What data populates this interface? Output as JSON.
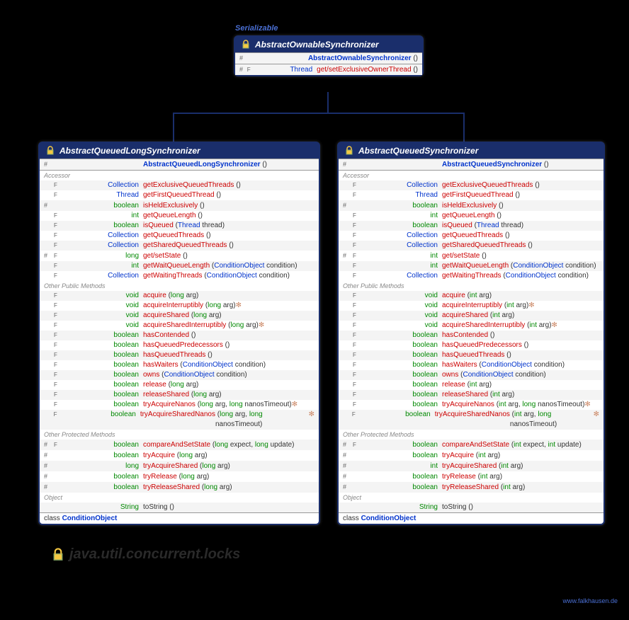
{
  "interface": "Serializable",
  "package": "java.util.concurrent.locks",
  "footer": "www.falkhausen.de",
  "parent": {
    "name": "AbstractOwnableSynchronizer",
    "ctor": "AbstractOwnableSynchronizer",
    "rows": [
      {
        "vis": "#",
        "mod": "F",
        "type": "Thread",
        "ctype": true,
        "method": "get/setExclusiveOwnerThread",
        "params": "()"
      }
    ]
  },
  "left": {
    "name": "AbstractQueuedLongSynchronizer",
    "ctor": "AbstractQueuedLongSynchronizer",
    "accessor": [
      {
        "vis": "",
        "mod": "F",
        "type": "Collection<Thread>",
        "ctype": true,
        "method": "getExclusiveQueuedThreads",
        "params": "()"
      },
      {
        "vis": "",
        "mod": "F",
        "type": "Thread",
        "ctype": true,
        "method": "getFirstQueuedThread",
        "params": "()"
      },
      {
        "vis": "#",
        "mod": "",
        "type": "boolean",
        "method": "isHeldExclusively",
        "params": "()"
      },
      {
        "vis": "",
        "mod": "F",
        "type": "int",
        "method": "getQueueLength",
        "params": "()"
      },
      {
        "vis": "",
        "mod": "F",
        "type": "boolean",
        "method": "isQueued",
        "params": "(Thread thread)"
      },
      {
        "vis": "",
        "mod": "F",
        "type": "Collection<Thread>",
        "ctype": true,
        "method": "getQueuedThreads",
        "params": "()"
      },
      {
        "vis": "",
        "mod": "F",
        "type": "Collection<Thread>",
        "ctype": true,
        "method": "getSharedQueuedThreads",
        "params": "()"
      },
      {
        "vis": "#",
        "mod": "F",
        "type": "long",
        "method": "get/setState",
        "params": "()"
      },
      {
        "vis": "",
        "mod": "F",
        "type": "int",
        "method": "getWaitQueueLength",
        "params": "(ConditionObject condition)"
      },
      {
        "vis": "",
        "mod": "F",
        "type": "Collection<Thread>",
        "ctype": true,
        "method": "getWaitingThreads",
        "params": "(ConditionObject condition)"
      }
    ],
    "public": [
      {
        "vis": "",
        "mod": "F",
        "type": "void",
        "method": "acquire",
        "params": "(long arg)"
      },
      {
        "vis": "",
        "mod": "F",
        "type": "void",
        "method": "acquireInterruptibly",
        "params": "(long arg)",
        "exc": "✻"
      },
      {
        "vis": "",
        "mod": "F",
        "type": "void",
        "method": "acquireShared",
        "params": "(long arg)"
      },
      {
        "vis": "",
        "mod": "F",
        "type": "void",
        "method": "acquireSharedInterruptibly",
        "params": "(long arg)",
        "exc": "✻"
      },
      {
        "vis": "",
        "mod": "F",
        "type": "boolean",
        "method": "hasContended",
        "params": "()"
      },
      {
        "vis": "",
        "mod": "F",
        "type": "boolean",
        "method": "hasQueuedPredecessors",
        "params": "()"
      },
      {
        "vis": "",
        "mod": "F",
        "type": "boolean",
        "method": "hasQueuedThreads",
        "params": "()"
      },
      {
        "vis": "",
        "mod": "F",
        "type": "boolean",
        "method": "hasWaiters",
        "params": "(ConditionObject condition)"
      },
      {
        "vis": "",
        "mod": "F",
        "type": "boolean",
        "method": "owns",
        "params": "(ConditionObject condition)"
      },
      {
        "vis": "",
        "mod": "F",
        "type": "boolean",
        "method": "release",
        "params": "(long arg)"
      },
      {
        "vis": "",
        "mod": "F",
        "type": "boolean",
        "method": "releaseShared",
        "params": "(long arg)"
      },
      {
        "vis": "",
        "mod": "F",
        "type": "boolean",
        "method": "tryAcquireNanos",
        "params": "(long arg, long nanosTimeout)",
        "exc": "✻"
      },
      {
        "vis": "",
        "mod": "F",
        "type": "boolean",
        "method": "tryAcquireSharedNanos",
        "params": "(long arg, long nanosTimeout)",
        "exc": "✻"
      }
    ],
    "protected": [
      {
        "vis": "#",
        "mod": "F",
        "type": "boolean",
        "method": "compareAndSetState",
        "params": "(long expect, long update)"
      },
      {
        "vis": "#",
        "mod": "",
        "type": "boolean",
        "method": "tryAcquire",
        "params": "(long arg)"
      },
      {
        "vis": "#",
        "mod": "",
        "type": "long",
        "method": "tryAcquireShared",
        "params": "(long arg)"
      },
      {
        "vis": "#",
        "mod": "",
        "type": "boolean",
        "method": "tryRelease",
        "params": "(long arg)"
      },
      {
        "vis": "#",
        "mod": "",
        "type": "boolean",
        "method": "tryReleaseShared",
        "params": "(long arg)"
      }
    ],
    "object": [
      {
        "vis": "",
        "mod": "",
        "type": "String",
        "method_plain": "toString",
        "params": "()"
      }
    ],
    "inner": "ConditionObject"
  },
  "right": {
    "name": "AbstractQueuedSynchronizer",
    "ctor": "AbstractQueuedSynchronizer",
    "accessor": [
      {
        "vis": "",
        "mod": "F",
        "type": "Collection<Thread>",
        "ctype": true,
        "method": "getExclusiveQueuedThreads",
        "params": "()"
      },
      {
        "vis": "",
        "mod": "F",
        "type": "Thread",
        "ctype": true,
        "method": "getFirstQueuedThread",
        "params": "()"
      },
      {
        "vis": "#",
        "mod": "",
        "type": "boolean",
        "method": "isHeldExclusively",
        "params": "()"
      },
      {
        "vis": "",
        "mod": "F",
        "type": "int",
        "method": "getQueueLength",
        "params": "()"
      },
      {
        "vis": "",
        "mod": "F",
        "type": "boolean",
        "method": "isQueued",
        "params": "(Thread thread)"
      },
      {
        "vis": "",
        "mod": "F",
        "type": "Collection<Thread>",
        "ctype": true,
        "method": "getQueuedThreads",
        "params": "()"
      },
      {
        "vis": "",
        "mod": "F",
        "type": "Collection<Thread>",
        "ctype": true,
        "method": "getSharedQueuedThreads",
        "params": "()"
      },
      {
        "vis": "#",
        "mod": "F",
        "type": "int",
        "method": "get/setState",
        "params": "()"
      },
      {
        "vis": "",
        "mod": "F",
        "type": "int",
        "method": "getWaitQueueLength",
        "params": "(ConditionObject condition)"
      },
      {
        "vis": "",
        "mod": "F",
        "type": "Collection<Thread>",
        "ctype": true,
        "method": "getWaitingThreads",
        "params": "(ConditionObject condition)"
      }
    ],
    "public": [
      {
        "vis": "",
        "mod": "F",
        "type": "void",
        "method": "acquire",
        "params": "(int arg)"
      },
      {
        "vis": "",
        "mod": "F",
        "type": "void",
        "method": "acquireInterruptibly",
        "params": "(int arg)",
        "exc": "✻"
      },
      {
        "vis": "",
        "mod": "F",
        "type": "void",
        "method": "acquireShared",
        "params": "(int arg)"
      },
      {
        "vis": "",
        "mod": "F",
        "type": "void",
        "method": "acquireSharedInterruptibly",
        "params": "(int arg)",
        "exc": "✻"
      },
      {
        "vis": "",
        "mod": "F",
        "type": "boolean",
        "method": "hasContended",
        "params": "()"
      },
      {
        "vis": "",
        "mod": "F",
        "type": "boolean",
        "method": "hasQueuedPredecessors",
        "params": "()"
      },
      {
        "vis": "",
        "mod": "F",
        "type": "boolean",
        "method": "hasQueuedThreads",
        "params": "()"
      },
      {
        "vis": "",
        "mod": "F",
        "type": "boolean",
        "method": "hasWaiters",
        "params": "(ConditionObject condition)"
      },
      {
        "vis": "",
        "mod": "F",
        "type": "boolean",
        "method": "owns",
        "params": "(ConditionObject condition)"
      },
      {
        "vis": "",
        "mod": "F",
        "type": "boolean",
        "method": "release",
        "params": "(int arg)"
      },
      {
        "vis": "",
        "mod": "F",
        "type": "boolean",
        "method": "releaseShared",
        "params": "(int arg)"
      },
      {
        "vis": "",
        "mod": "F",
        "type": "boolean",
        "method": "tryAcquireNanos",
        "params": "(int arg, long nanosTimeout)",
        "exc": "✻"
      },
      {
        "vis": "",
        "mod": "F",
        "type": "boolean",
        "method": "tryAcquireSharedNanos",
        "params": "(int arg, long nanosTimeout)",
        "exc": "✻"
      }
    ],
    "protected": [
      {
        "vis": "#",
        "mod": "F",
        "type": "boolean",
        "method": "compareAndSetState",
        "params": "(int expect, int update)"
      },
      {
        "vis": "#",
        "mod": "",
        "type": "boolean",
        "method": "tryAcquire",
        "params": "(int arg)"
      },
      {
        "vis": "#",
        "mod": "",
        "type": "int",
        "method": "tryAcquireShared",
        "params": "(int arg)"
      },
      {
        "vis": "#",
        "mod": "",
        "type": "boolean",
        "method": "tryRelease",
        "params": "(int arg)"
      },
      {
        "vis": "#",
        "mod": "",
        "type": "boolean",
        "method": "tryReleaseShared",
        "params": "(int arg)"
      }
    ],
    "object": [
      {
        "vis": "",
        "mod": "",
        "type": "String",
        "method_plain": "toString",
        "params": "()"
      }
    ],
    "inner": "ConditionObject"
  },
  "labels": {
    "accessor": "Accessor",
    "public": "Other Public Methods",
    "protected": "Other Protected Methods",
    "object": "Object",
    "class": "class"
  }
}
